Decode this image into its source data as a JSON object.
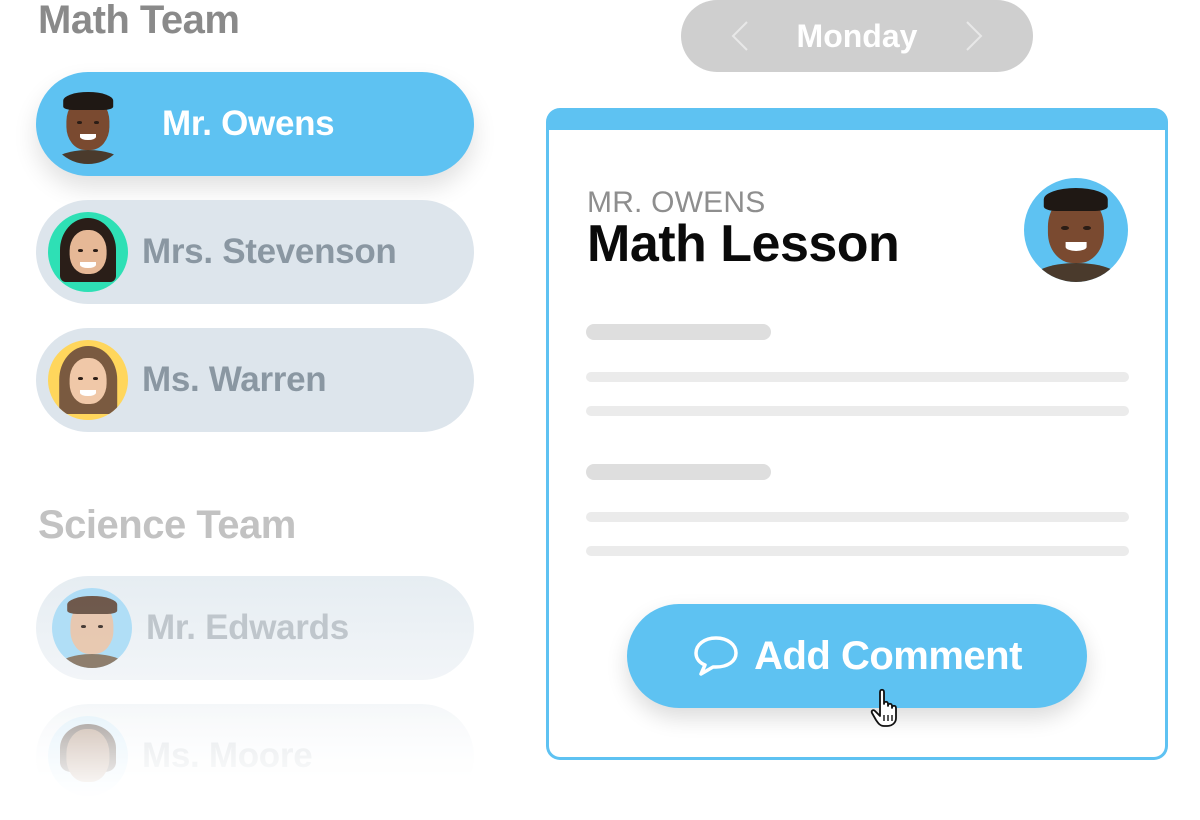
{
  "teams": [
    {
      "heading": "Math Team",
      "teachers": [
        {
          "name": "Mr. Owens",
          "state": "selected",
          "avatar_bg": "#5ec2f2"
        },
        {
          "name": "Mrs. Stevenson",
          "state": "default",
          "avatar_bg": "#2ee0b5"
        },
        {
          "name": "Ms. Warren",
          "state": "default",
          "avatar_bg": "#ffd65c"
        }
      ]
    },
    {
      "heading": "Science Team",
      "teachers": [
        {
          "name": "Mr. Edwards",
          "state": "faded",
          "avatar_bg": "#a6dbf7"
        },
        {
          "name": "Ms. Moore",
          "state": "faded",
          "avatar_bg": "#d6eefb"
        }
      ]
    }
  ],
  "day_switcher": {
    "day": "Monday",
    "prev_icon": "chevron-left-icon",
    "next_icon": "chevron-right-icon"
  },
  "lesson_card": {
    "teacher_label": "MR. OWENS",
    "title": "Math Lesson",
    "avatar_bg": "#5ec2f2",
    "accent_color": "#5ec2f2",
    "action": {
      "label": "Add Comment",
      "icon": "speech-bubble-icon"
    }
  },
  "colors": {
    "primary": "#5ec2f2",
    "pill_idle": "#dde5ec",
    "pill_idle_text": "#8a97a2",
    "switcher_bg": "#cfcfcf"
  }
}
